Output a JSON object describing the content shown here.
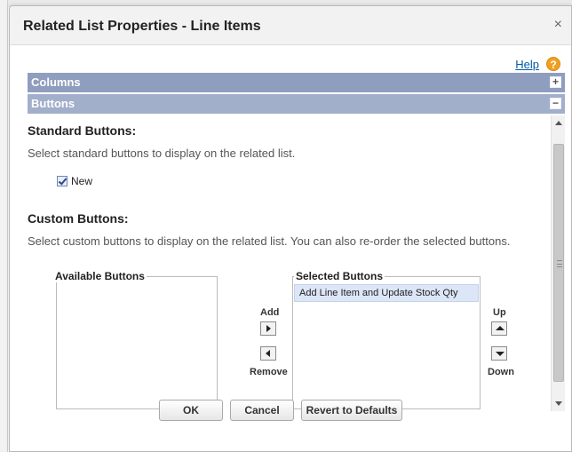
{
  "dialog": {
    "title": "Related List Properties - Line Items",
    "close_glyph": "×",
    "help_label": "Help",
    "help_glyph": "?"
  },
  "sections": {
    "columns_label": "Columns",
    "columns_toggle": "+",
    "buttons_label": "Buttons",
    "buttons_toggle": "−"
  },
  "standard_buttons": {
    "heading": "Standard Buttons:",
    "description": "Select standard buttons to display on the related list.",
    "checkbox_label": "New",
    "checked": true
  },
  "custom_buttons": {
    "heading": "Custom Buttons:",
    "description": "Select custom buttons to display on the related list. You can also re-order the selected buttons.",
    "available_label": "Available Buttons",
    "selected_label": "Selected Buttons",
    "selected_items": [
      "Add Line Item and Update Stock Qty"
    ],
    "add_label": "Add",
    "remove_label": "Remove",
    "up_label": "Up",
    "down_label": "Down"
  },
  "footer": {
    "ok_label": "OK",
    "cancel_label": "Cancel",
    "revert_label": "Revert to Defaults"
  },
  "colors": {
    "section_bar": "#9ca9c8",
    "selected_item_bg": "#dce6f7",
    "help_icon": "#f0a020",
    "link": "#015ba7"
  },
  "icons": {
    "close": "close-icon",
    "help": "help-icon",
    "expand": "plus-icon",
    "collapse": "minus-icon",
    "add": "arrow-right-icon",
    "remove": "arrow-left-icon",
    "up": "arrow-up-icon",
    "down": "arrow-down-icon"
  }
}
